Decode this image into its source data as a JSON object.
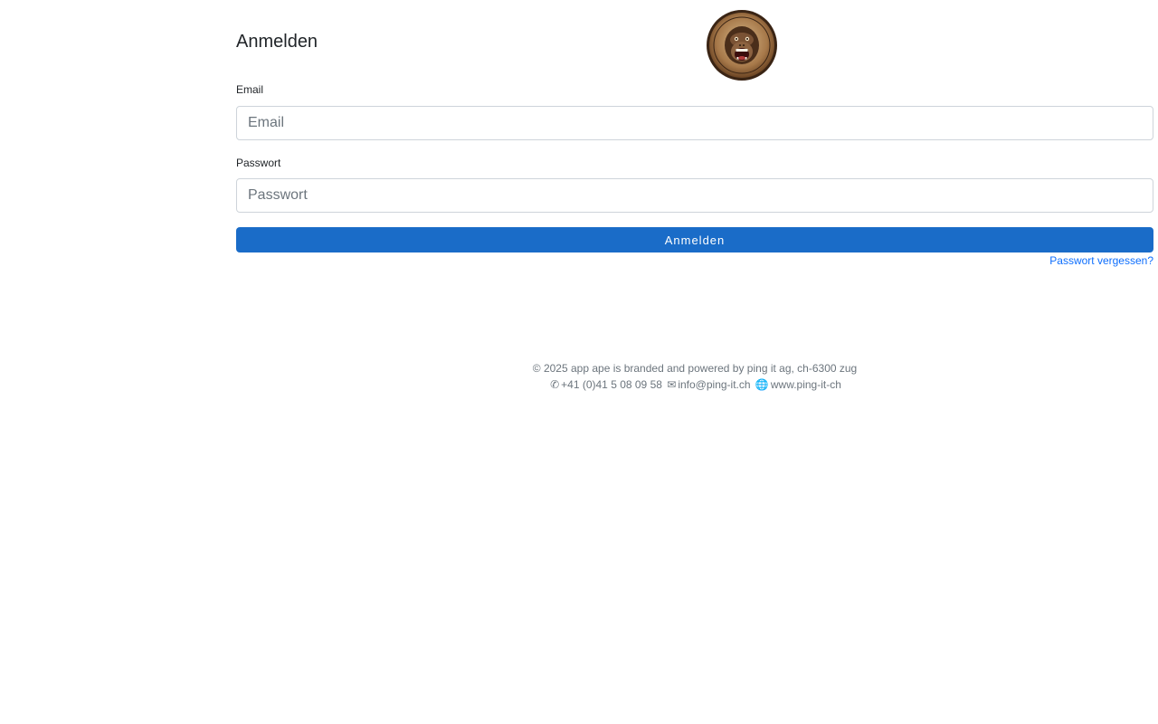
{
  "login": {
    "title": "Anmelden",
    "email_label": "Email",
    "email_placeholder": "Email",
    "email_value": "",
    "password_label": "Passwort",
    "password_placeholder": "Passwort",
    "password_value": "",
    "submit_label": "Anmelden",
    "forgot_label": "Passwort vergessen?",
    "logo_icon": "gorilla-badge-logo"
  },
  "footer": {
    "copyright": "© 2025 app ape is branded and powered by ping it ag, ch-6300 zug",
    "phone_icon": "✆",
    "phone": "+41 (0)41 5 08 09 58",
    "mail_icon": "✉",
    "email": "info@ping-it.ch",
    "web_icon": "🌐",
    "website": "www.ping-it-ch"
  },
  "colors": {
    "primary": "#1a6cc8",
    "link": "#0d6efd",
    "muted": "#6c757d"
  }
}
